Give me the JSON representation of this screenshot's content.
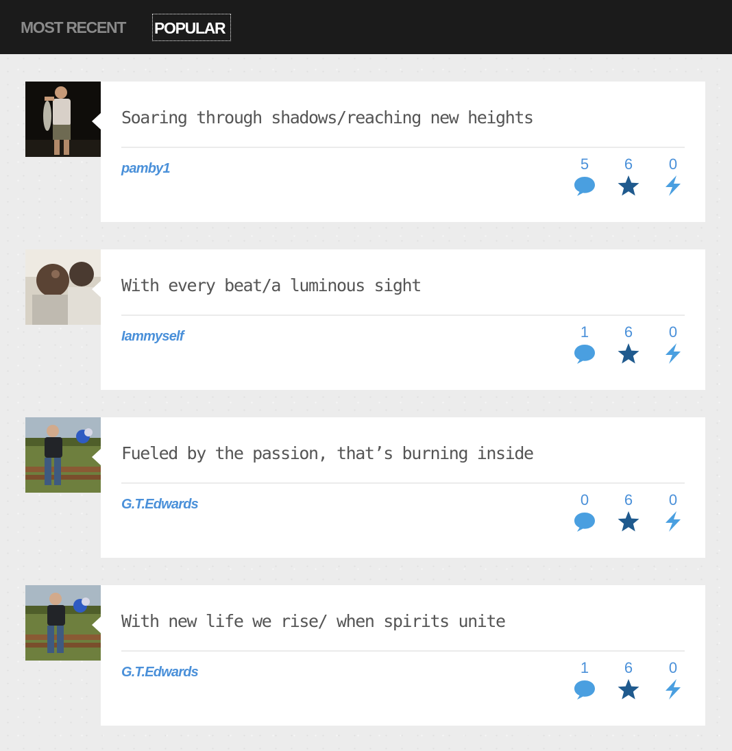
{
  "nav": {
    "tabs": [
      {
        "label": "MOST RECENT",
        "active": false
      },
      {
        "label": "POPULAR",
        "active": true
      }
    ]
  },
  "colors": {
    "topbar": "#1b1b1b",
    "link": "#4a90d9",
    "star": "#1f5a8e",
    "title": "#555555"
  },
  "icons": {
    "comments": "speech-bubble-icon",
    "stars": "star-icon",
    "boosts": "lightning-bolt-icon"
  },
  "posts": [
    {
      "title": "Soaring through shadows/reaching new heights",
      "author": "pamby1",
      "comments": "5",
      "stars": "6",
      "boosts": "0"
    },
    {
      "title": "With every beat/a luminous sight",
      "author": "Iammyself",
      "comments": "1",
      "stars": "6",
      "boosts": "0"
    },
    {
      "title": "Fueled by the passion, that’s burning inside",
      "author": "G.T.Edwards",
      "comments": "0",
      "stars": "6",
      "boosts": "0"
    },
    {
      "title": "With new life we rise/ when spirits unite",
      "author": "G.T.Edwards",
      "comments": "1",
      "stars": "6",
      "boosts": "0"
    }
  ]
}
